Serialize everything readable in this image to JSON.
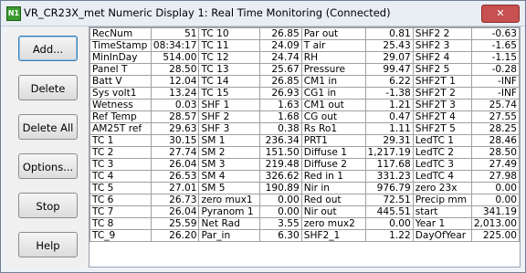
{
  "window": {
    "title": "VR_CR23X_met Numeric Display 1: Real Time Monitoring (Connected)",
    "icon": "N1",
    "close": "✕"
  },
  "buttons": [
    {
      "name": "add-button",
      "label": "Add..."
    },
    {
      "name": "delete-button",
      "label": "Delete"
    },
    {
      "name": "delete-all-button",
      "label": "Delete All"
    },
    {
      "name": "options-button",
      "label": "Options..."
    },
    {
      "name": "stop-button",
      "label": "Stop"
    },
    {
      "name": "help-button",
      "label": "Help"
    }
  ],
  "rows": [
    [
      [
        "RecNum",
        "51"
      ],
      [
        "TC 10",
        "26.85"
      ],
      [
        "Par out",
        "0.81"
      ],
      [
        "SHF2 2",
        "-0.63"
      ]
    ],
    [
      [
        "TimeStamp",
        "08:34:17"
      ],
      [
        "TC 11",
        "24.09"
      ],
      [
        "T air",
        "25.43"
      ],
      [
        "SHF2 3",
        "-1.65"
      ]
    ],
    [
      [
        "MinInDay",
        "514.00"
      ],
      [
        "TC 12",
        "24.74"
      ],
      [
        "RH",
        "29.07"
      ],
      [
        "SHF2 4",
        "-1.15"
      ]
    ],
    [
      [
        "Panel T",
        "28.50"
      ],
      [
        "TC 13",
        "25.67"
      ],
      [
        "Pressure",
        "99.47"
      ],
      [
        "SHF2 5",
        "-0.28"
      ]
    ],
    [
      [
        "Batt V",
        "12.04"
      ],
      [
        "TC 14",
        "26.85"
      ],
      [
        "CM1 in",
        "6.22"
      ],
      [
        "SHF2T 1",
        "-INF"
      ]
    ],
    [
      [
        "Sys volt1",
        "13.24"
      ],
      [
        "TC 15",
        "26.93"
      ],
      [
        "CG1 in",
        "-1.38"
      ],
      [
        "SHF2T 2",
        "-INF"
      ]
    ],
    [
      [
        "Wetness",
        "0.03"
      ],
      [
        "SHF 1",
        "1.63"
      ],
      [
        "CM1 out",
        "1.21"
      ],
      [
        "SHF2T 3",
        "25.74"
      ]
    ],
    [
      [
        "Ref Temp",
        "28.57"
      ],
      [
        "SHF 2",
        "1.68"
      ],
      [
        "CG out",
        "0.47"
      ],
      [
        "SHF2T 4",
        "27.55"
      ]
    ],
    [
      [
        "AM25T ref",
        "29.63"
      ],
      [
        "SHF 3",
        "0.38"
      ],
      [
        "Rs Ro1",
        "1.11"
      ],
      [
        "SHF2T 5",
        "28.25"
      ]
    ],
    [
      [
        "TC 1",
        "30.15"
      ],
      [
        "SM 1",
        "236.34"
      ],
      [
        "PRT1",
        "29.31"
      ],
      [
        "LedTC 1",
        "28.46"
      ]
    ],
    [
      [
        "TC 2",
        "27.74"
      ],
      [
        "SM 2",
        "151.50"
      ],
      [
        "Diffuse 1",
        "1,217.19"
      ],
      [
        "LedTC 2",
        "28.50"
      ]
    ],
    [
      [
        "TC 3",
        "26.04"
      ],
      [
        "SM 3",
        "219.48"
      ],
      [
        "Diffuse 2",
        "117.68"
      ],
      [
        "LedTC 3",
        "27.49"
      ]
    ],
    [
      [
        "TC 4",
        "26.53"
      ],
      [
        "SM 4",
        "326.62"
      ],
      [
        "Red in 1",
        "331.23"
      ],
      [
        "LedTC 4",
        "27.98"
      ]
    ],
    [
      [
        "TC 5",
        "27.01"
      ],
      [
        "SM 5",
        "190.89"
      ],
      [
        "Nir in",
        "976.79"
      ],
      [
        "zero 23x",
        "0.00"
      ]
    ],
    [
      [
        "TC 6",
        "26.73"
      ],
      [
        "zero mux1",
        "0.00"
      ],
      [
        "Red out",
        "72.51"
      ],
      [
        "Precip mm",
        "0.00"
      ]
    ],
    [
      [
        "TC 7",
        "26.04"
      ],
      [
        "Pyranom 1",
        "0.00"
      ],
      [
        "Nir out",
        "445.51"
      ],
      [
        "start",
        "341.19"
      ]
    ],
    [
      [
        "TC 8",
        "25.59"
      ],
      [
        "Net Rad",
        "3.55"
      ],
      [
        "zero mux2",
        "0.00"
      ],
      [
        "Year 1",
        "2,013.00"
      ]
    ],
    [
      [
        "TC_9",
        "26.20"
      ],
      [
        "Par_in",
        "6.30"
      ],
      [
        "SHF2_1",
        "1.22"
      ],
      [
        "DayOfYear",
        "225.00"
      ]
    ]
  ]
}
